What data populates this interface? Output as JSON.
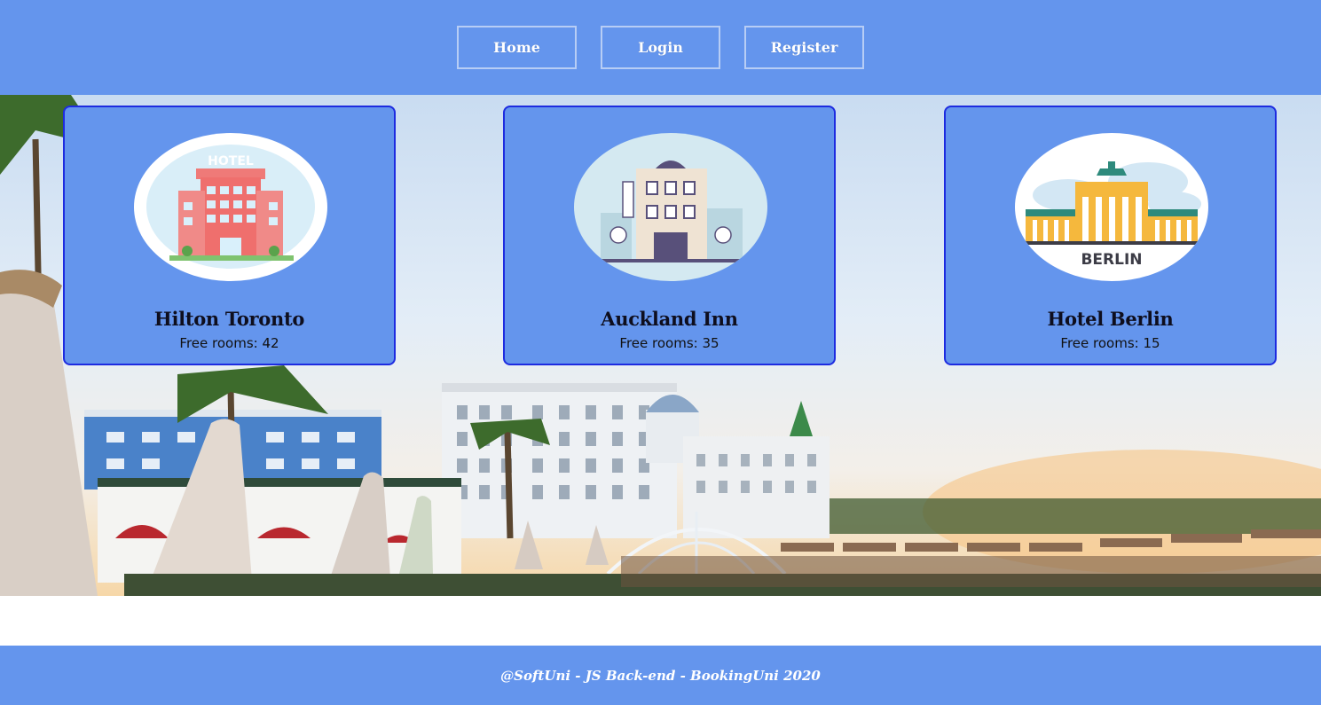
{
  "nav": {
    "home_label": "Home",
    "login_label": "Login",
    "register_label": "Register"
  },
  "hotels": [
    {
      "name": "Hilton Toronto",
      "rooms_label": "Free rooms: 42",
      "thumb_icon": "hotel-building-image",
      "thumb_text": "HOTEL"
    },
    {
      "name": "Auckland Inn",
      "rooms_label": "Free rooms: 35",
      "thumb_icon": "hotel-building-image"
    },
    {
      "name": "Hotel Berlin",
      "rooms_label": "Free rooms: 15",
      "thumb_icon": "brandenburg-gate-image",
      "thumb_text": "BERLIN"
    }
  ],
  "footer": {
    "text": "@SoftUni - JS Back-end - BookingUni 2020"
  },
  "colors": {
    "primary": "#6495ed",
    "card_border": "#1d2be0",
    "text_light": "#ffffff"
  }
}
